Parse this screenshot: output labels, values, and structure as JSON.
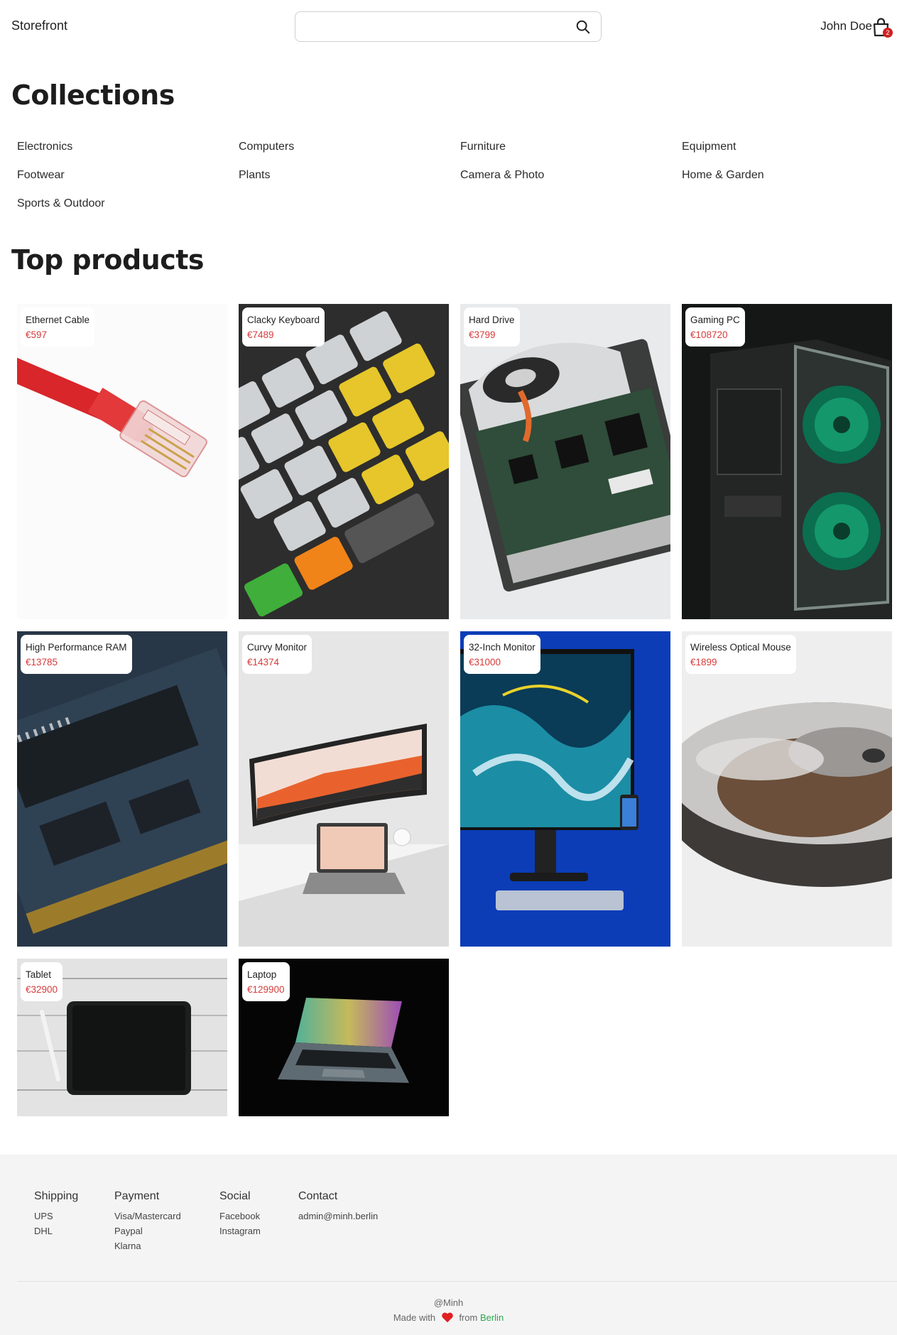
{
  "header": {
    "brand": "Storefront",
    "search_placeholder": "",
    "user_name": "John Doe",
    "cart_count": "2",
    "icons": {
      "search": "search-icon",
      "cart": "shopping-bag-icon"
    }
  },
  "collections": {
    "title": "Collections",
    "items": [
      "Electronics",
      "Computers",
      "Furniture",
      "Equipment",
      "Footwear",
      "Plants",
      "Camera & Photo",
      "Home & Garden",
      "Sports & Outdoor"
    ]
  },
  "products": {
    "title": "Top products",
    "items": [
      {
        "name": "Ethernet Cable",
        "price": "€597"
      },
      {
        "name": "Clacky Keyboard",
        "price": "€7489"
      },
      {
        "name": "Hard Drive",
        "price": "€3799"
      },
      {
        "name": "Gaming PC",
        "price": "€108720"
      },
      {
        "name": "High Performance RAM",
        "price": "€13785"
      },
      {
        "name": "Curvy Monitor",
        "price": "€14374"
      },
      {
        "name": "32-Inch Monitor",
        "price": "€31000"
      },
      {
        "name": "Wireless Optical Mouse",
        "price": "€1899"
      },
      {
        "name": "Tablet",
        "price": "€32900"
      },
      {
        "name": "Laptop",
        "price": "€129900"
      }
    ]
  },
  "footer": {
    "columns": [
      {
        "title": "Shipping",
        "items": [
          "UPS",
          "DHL"
        ]
      },
      {
        "title": "Payment",
        "items": [
          "Visa/Mastercard",
          "Paypal",
          "Klarna"
        ]
      },
      {
        "title": "Social",
        "items": [
          "Facebook",
          "Instagram"
        ]
      },
      {
        "title": "Contact",
        "items": [
          "admin@minh.berlin"
        ]
      }
    ],
    "handle": "@Minh",
    "made_with": "Made with",
    "from": "from",
    "city": "Berlin",
    "colors": {
      "heart": "#e02020",
      "city": "#27a84a",
      "price": "#d63b3b"
    }
  }
}
